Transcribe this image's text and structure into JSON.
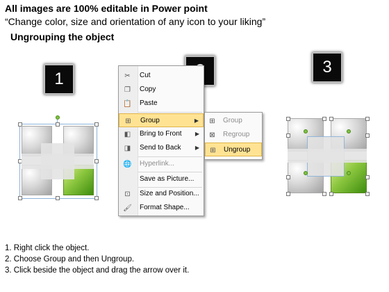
{
  "header": {
    "title": "All images are 100% editable in Power point",
    "subtitle": "“Change color, size and orientation of any icon to your liking”",
    "section": "Ungrouping the object"
  },
  "badges": [
    "1",
    "2",
    "3"
  ],
  "context_menu": {
    "items": [
      {
        "label": "Cut",
        "icon": "scissors-icon"
      },
      {
        "label": "Copy",
        "icon": "copy-icon"
      },
      {
        "label": "Paste",
        "icon": "paste-icon"
      },
      {
        "label": "Group",
        "icon": "group-icon",
        "has_submenu": true,
        "highlighted": true
      },
      {
        "label": "Bring to Front",
        "icon": "bring-front-icon",
        "has_submenu": true
      },
      {
        "label": "Send to Back",
        "icon": "send-back-icon",
        "has_submenu": true
      },
      {
        "label": "Hyperlink...",
        "icon": "hyperlink-icon",
        "disabled": true
      },
      {
        "label": "Save as Picture...",
        "icon": ""
      },
      {
        "label": "Size and Position...",
        "icon": "size-position-icon"
      },
      {
        "label": "Format Shape...",
        "icon": "format-shape-icon"
      }
    ],
    "submenu": [
      {
        "label": "Group",
        "icon": "group-icon",
        "disabled": true
      },
      {
        "label": "Regroup",
        "icon": "regroup-icon",
        "disabled": true
      },
      {
        "label": "Ungroup",
        "icon": "ungroup-icon",
        "highlighted": true
      }
    ]
  },
  "steps": [
    "1.   Right click the object.",
    "2.   Choose Group and then Ungroup.",
    "3.   Click beside the object and drag the arrow over it."
  ],
  "colors": {
    "menu_highlight": "#ffe393",
    "tile_green": "#8cc63f",
    "rotate_handle": "#7fc241"
  }
}
